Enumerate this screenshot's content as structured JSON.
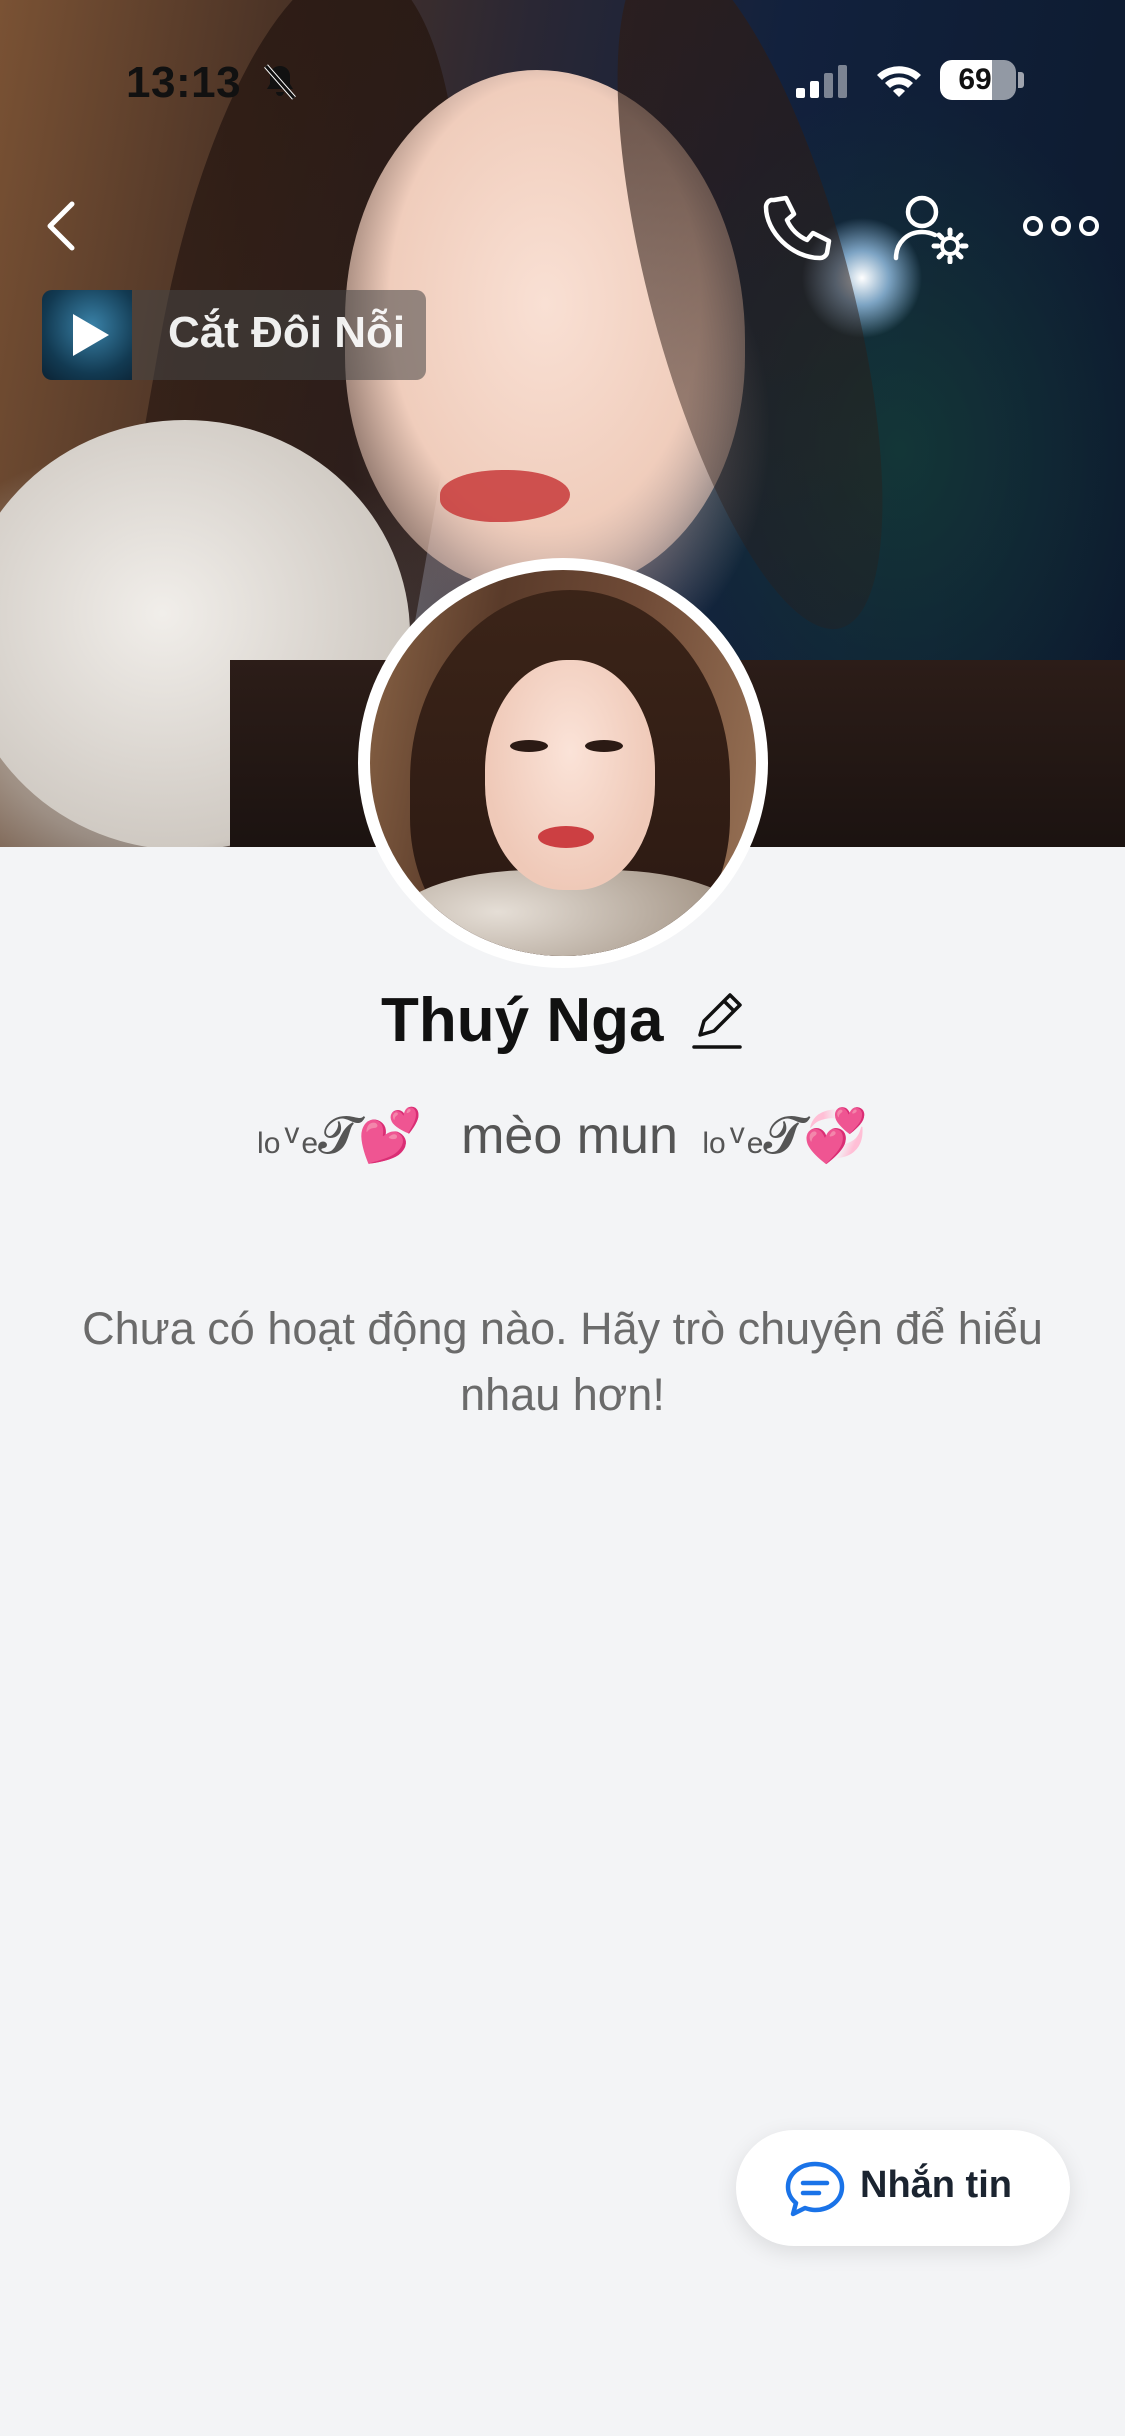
{
  "status_bar": {
    "time": "13:13",
    "battery_percent": "69",
    "battery_level": 0.69
  },
  "music": {
    "song_title": "Cắt Đôi Nỗi"
  },
  "profile": {
    "name": "Thuý Nga",
    "bio_parts": {
      "left_small": "lo",
      "left_small2": "v",
      "left_small3": "e",
      "left_glyph": "𝓣💕",
      "middle": "mèo mun",
      "right_small": "lo",
      "right_small2": "v",
      "right_small3": "e",
      "right_glyph": "𝓣💞"
    }
  },
  "feed": {
    "empty_message": "Chưa có hoạt động nào. Hãy trò chuyện để hiểu nhau hơn!"
  },
  "actions": {
    "message_button": "Nhắn tin"
  },
  "icons": {
    "back": "chevron-left-icon",
    "call": "phone-icon",
    "profile_settings": "user-settings-icon",
    "more": "more-dots-icon",
    "edit": "pencil-icon",
    "message": "chat-bubble-icon",
    "play": "play-icon",
    "mute": "bell-off-icon"
  },
  "colors": {
    "background": "#f3f4f6",
    "accent": "#1a73e8"
  }
}
